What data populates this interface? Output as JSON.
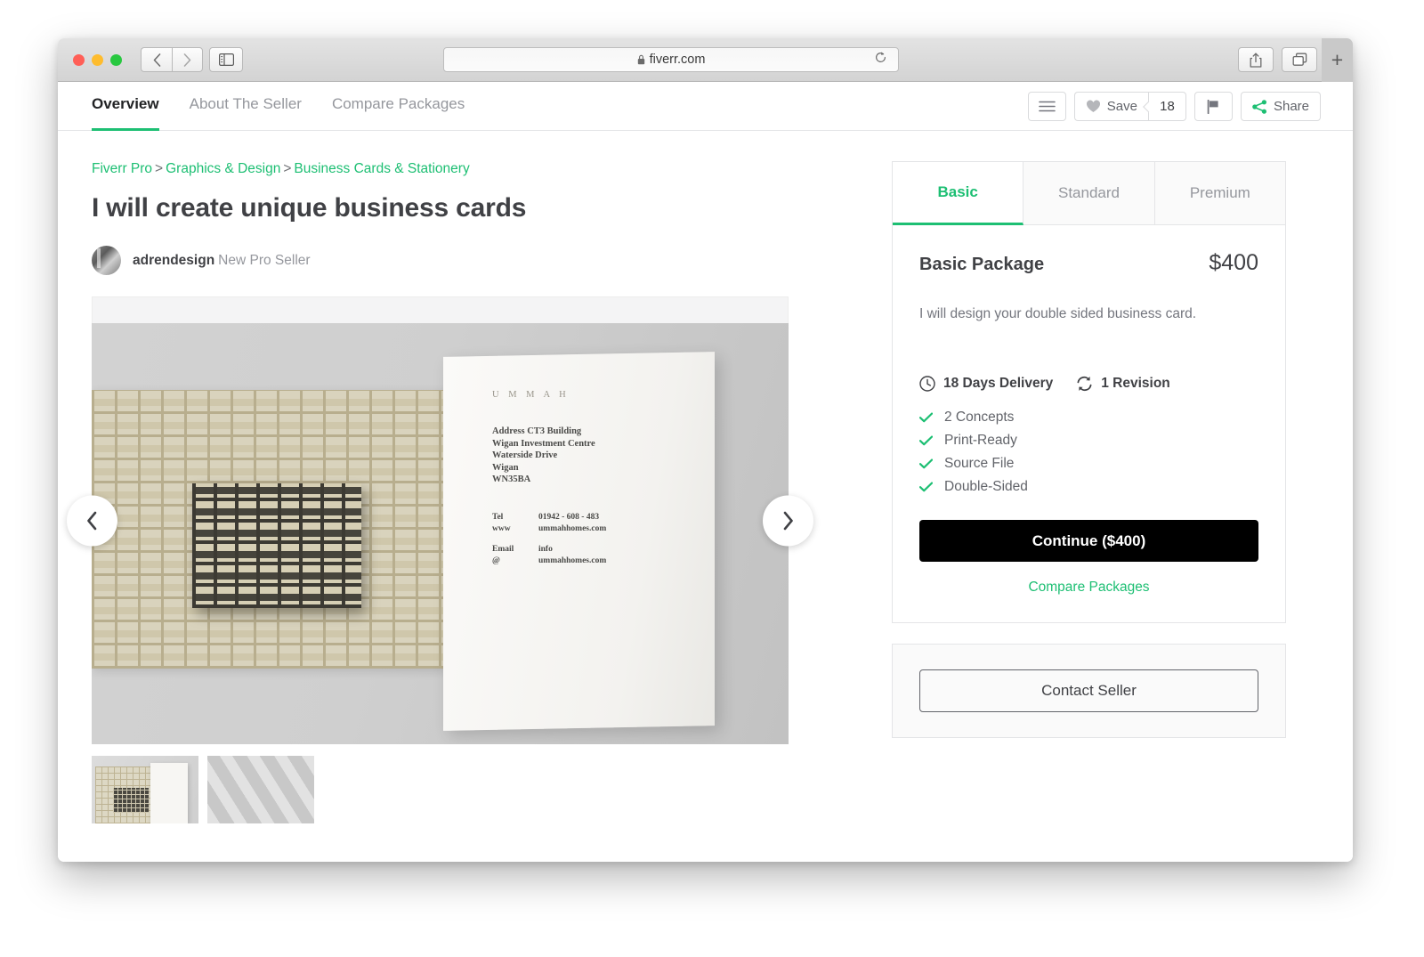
{
  "browser": {
    "url": "fiverr.com",
    "lock_icon": "lock-icon",
    "back_icon": "chevron-left-icon",
    "forward_icon": "chevron-right-icon",
    "sidebar_icon": "sidebar-icon",
    "reload_icon": "reload-icon",
    "share_icon": "share-upload-icon",
    "tabs_icon": "tab-overview-icon",
    "new_tab_label": "+"
  },
  "header": {
    "tabs": [
      {
        "label": "Overview",
        "active": true
      },
      {
        "label": "About The Seller",
        "active": false
      },
      {
        "label": "Compare Packages",
        "active": false
      }
    ],
    "menu_icon": "hamburger-menu-icon",
    "save_label": "Save",
    "save_icon": "heart-icon",
    "save_count": "18",
    "report_icon": "flag-icon",
    "share_label": "Share",
    "share_icon": "share-nodes-icon"
  },
  "breadcrumb": {
    "items": [
      "Fiverr Pro",
      "Graphics & Design",
      "Business Cards & Stationery"
    ],
    "separator": ">"
  },
  "gig": {
    "title": "I will create unique business cards",
    "seller_name": "adrendesign",
    "seller_level": "New Pro Seller"
  },
  "gallery": {
    "prev_icon": "chevron-left-icon",
    "next_icon": "chevron-right-icon",
    "card_brand": "U M M A H",
    "card_address": "Address CT3 Building\nWigan Investment Centre\nWaterside Drive\nWigan\nWN35BA",
    "card_contact": [
      {
        "label": "Tel",
        "value": "01942 - 608 - 483"
      },
      {
        "label": "www",
        "value": "ummahhomes.com"
      },
      {
        "label": "Email",
        "value": "info"
      },
      {
        "label": "@",
        "value": "ummahhomes.com"
      }
    ],
    "thumbnails": [
      "thumbnail-1",
      "thumbnail-2"
    ]
  },
  "packages": {
    "tabs": [
      {
        "label": "Basic",
        "active": true
      },
      {
        "label": "Standard",
        "active": false
      },
      {
        "label": "Premium",
        "active": false
      }
    ],
    "name": "Basic Package",
    "price": "$400",
    "description": "I will design your double sided business card.",
    "delivery": "18 Days Delivery",
    "delivery_icon": "clock-icon",
    "revisions": "1 Revision",
    "revisions_icon": "refresh-icon",
    "features": [
      "2 Concepts",
      "Print-Ready",
      "Source File",
      "Double-Sided"
    ],
    "continue_label": "Continue ($400)",
    "compare_label": "Compare Packages"
  },
  "contact": {
    "button_label": "Contact Seller"
  },
  "colors": {
    "accent": "#1dbf73",
    "text_primary": "#404145",
    "text_muted": "#95979d",
    "cta": "#000000"
  }
}
